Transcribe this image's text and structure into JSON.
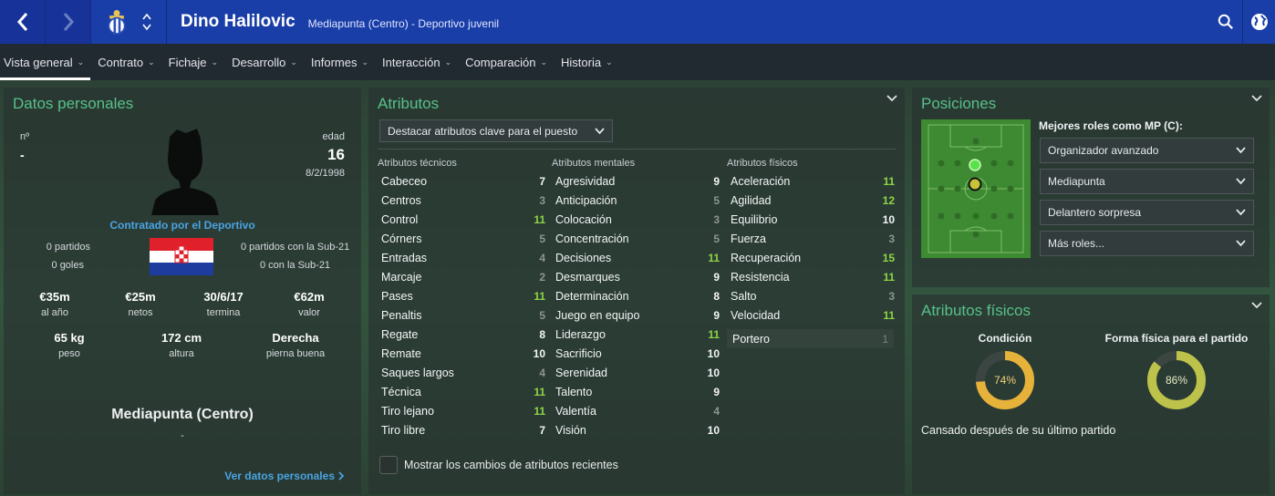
{
  "header": {
    "player_name": "Dino Halilovic",
    "player_subtitle": "Mediapunta (Centro) - Deportivo juvenil"
  },
  "tabs": [
    {
      "label": "Vista general"
    },
    {
      "label": "Contrato"
    },
    {
      "label": "Fichaje"
    },
    {
      "label": "Desarrollo"
    },
    {
      "label": "Informes"
    },
    {
      "label": "Interacción"
    },
    {
      "label": "Comparación"
    },
    {
      "label": "Historia"
    }
  ],
  "personal": {
    "title": "Datos personales",
    "number_label": "nº",
    "number_value": "-",
    "age_label": "edad",
    "age_value": "16",
    "dob": "8/2/1998",
    "contract_link": "Contratado por el Deportivo",
    "matches": "0 partidos",
    "goals": "0 goles",
    "u21_matches": "0 partidos con la Sub-21",
    "u21_goals": "0 con la Sub-21",
    "stats": [
      {
        "value": "€35m",
        "label": "al año"
      },
      {
        "value": "€25m",
        "label": "netos"
      },
      {
        "value": "30/6/17",
        "label": "termina"
      },
      {
        "value": "€62m",
        "label": "valor"
      }
    ],
    "body": [
      {
        "value": "65 kg",
        "label": "peso"
      },
      {
        "value": "172 cm",
        "label": "altura"
      },
      {
        "value": "Derecha",
        "label": "pierna buena"
      }
    ],
    "position": "Mediapunta (Centro)",
    "position_dash": "-",
    "view_link": "Ver datos personales"
  },
  "attributes": {
    "title": "Atributos",
    "highlight_dropdown": "Destacar atributos clave para el puesto",
    "technical_header": "Atributos técnicos",
    "mental_header": "Atributos mentales",
    "physical_header": "Atributos físicos",
    "technical": [
      {
        "name": "Cabeceo",
        "value": "7",
        "tone": "white"
      },
      {
        "name": "Centros",
        "value": "3",
        "tone": "grey"
      },
      {
        "name": "Control",
        "value": "11",
        "tone": "green"
      },
      {
        "name": "Córners",
        "value": "5",
        "tone": "grey"
      },
      {
        "name": "Entradas",
        "value": "4",
        "tone": "grey"
      },
      {
        "name": "Marcaje",
        "value": "2",
        "tone": "grey"
      },
      {
        "name": "Pases",
        "value": "11",
        "tone": "green"
      },
      {
        "name": "Penaltis",
        "value": "5",
        "tone": "grey"
      },
      {
        "name": "Regate",
        "value": "8",
        "tone": "white"
      },
      {
        "name": "Remate",
        "value": "10",
        "tone": "white"
      },
      {
        "name": "Saques largos",
        "value": "4",
        "tone": "grey"
      },
      {
        "name": "Técnica",
        "value": "11",
        "tone": "green"
      },
      {
        "name": "Tiro lejano",
        "value": "11",
        "tone": "green"
      },
      {
        "name": "Tiro libre",
        "value": "7",
        "tone": "white"
      }
    ],
    "mental": [
      {
        "name": "Agresividad",
        "value": "9",
        "tone": "white"
      },
      {
        "name": "Anticipación",
        "value": "5",
        "tone": "grey"
      },
      {
        "name": "Colocación",
        "value": "3",
        "tone": "grey"
      },
      {
        "name": "Concentración",
        "value": "5",
        "tone": "grey"
      },
      {
        "name": "Decisiones",
        "value": "11",
        "tone": "green"
      },
      {
        "name": "Desmarques",
        "value": "9",
        "tone": "white"
      },
      {
        "name": "Determinación",
        "value": "8",
        "tone": "white"
      },
      {
        "name": "Juego en equipo",
        "value": "9",
        "tone": "white"
      },
      {
        "name": "Liderazgo",
        "value": "11",
        "tone": "green"
      },
      {
        "name": "Sacrificio",
        "value": "10",
        "tone": "white"
      },
      {
        "name": "Serenidad",
        "value": "10",
        "tone": "white"
      },
      {
        "name": "Talento",
        "value": "9",
        "tone": "white"
      },
      {
        "name": "Valentía",
        "value": "4",
        "tone": "grey"
      },
      {
        "name": "Visión",
        "value": "10",
        "tone": "white"
      }
    ],
    "physical": [
      {
        "name": "Aceleración",
        "value": "11",
        "tone": "green"
      },
      {
        "name": "Agilidad",
        "value": "12",
        "tone": "green"
      },
      {
        "name": "Equilibrio",
        "value": "10",
        "tone": "white"
      },
      {
        "name": "Fuerza",
        "value": "3",
        "tone": "grey"
      },
      {
        "name": "Recuperación",
        "value": "15",
        "tone": "green"
      },
      {
        "name": "Resistencia",
        "value": "11",
        "tone": "green"
      },
      {
        "name": "Salto",
        "value": "3",
        "tone": "grey"
      },
      {
        "name": "Velocidad",
        "value": "11",
        "tone": "green"
      }
    ],
    "goalkeeper": {
      "name": "Portero",
      "value": "1"
    },
    "show_changes_label": "Mostrar los cambios de atributos recientes"
  },
  "positions": {
    "title": "Posiciones",
    "best_roles_label": "Mejores roles como MP (C):",
    "roles": [
      "Organizador avanzado",
      "Mediapunta",
      "Delantero sorpresa",
      "Más roles..."
    ]
  },
  "physical_panel": {
    "title": "Atributos físicos",
    "condition_label": "Condición",
    "condition_value": "74%",
    "condition_fraction": 0.74,
    "match_fitness_label": "Forma física para el partido",
    "match_fitness_value": "86%",
    "match_fitness_fraction": 0.86,
    "status_text": "Cansado después de su último partido"
  },
  "colors": {
    "accent_green": "#58c08a",
    "header_blue": "#1a3ea7",
    "condition_ring": "#e6b23a",
    "fitness_ring": "#bcc24a"
  }
}
